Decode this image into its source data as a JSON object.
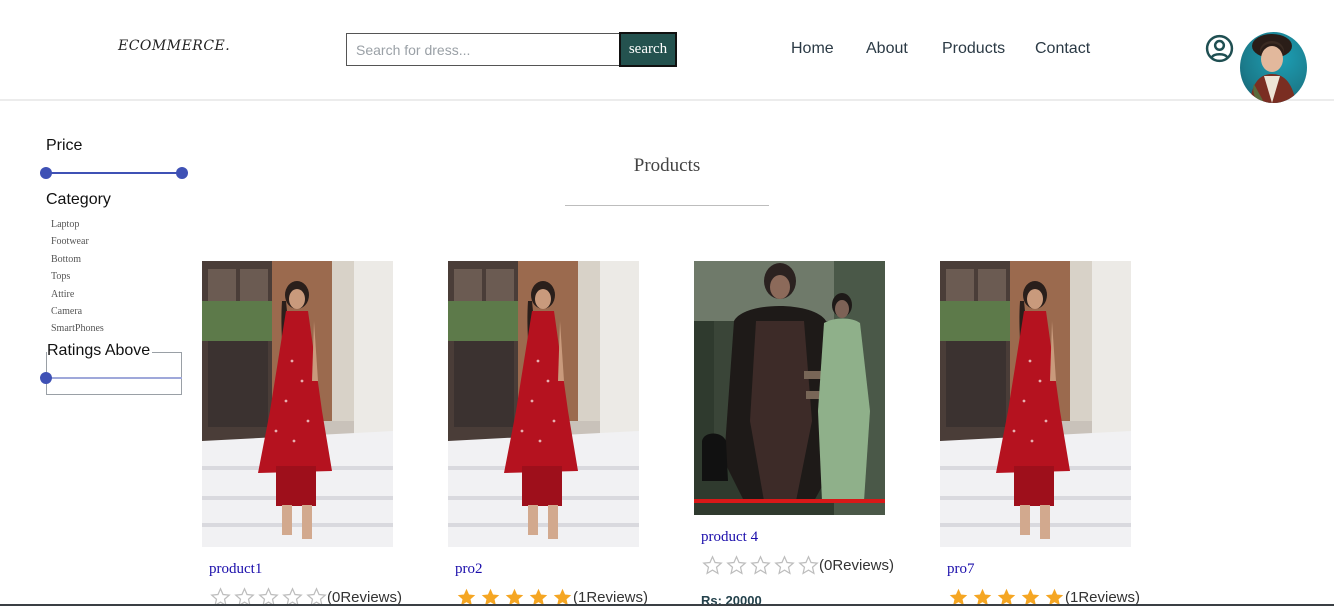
{
  "header": {
    "logo": "ECOMMERCE.",
    "search": {
      "placeholder": "Search for dress...",
      "value": "",
      "button_label": "search"
    },
    "nav": [
      "Home",
      "About",
      "Products",
      "Contact"
    ],
    "user_icon": "user-circle-icon"
  },
  "filters": {
    "price_title": "Price",
    "price_range": [
      0,
      1
    ],
    "category_title": "Category",
    "categories": [
      "Laptop",
      "Footwear",
      "Bottom",
      "Tops",
      "Attire",
      "Camera",
      "SmartPhones"
    ],
    "ratings_title": "Ratings Above",
    "ratings_value": 0
  },
  "main": {
    "title": "Products",
    "products": [
      {
        "name": "product1",
        "rating": 0,
        "reviews": "(0Reviews)",
        "price": ""
      },
      {
        "name": "pro2",
        "rating": 5,
        "reviews": "(1Reviews)",
        "price": ""
      },
      {
        "name": "product 4",
        "rating": 0,
        "reviews": "(0Reviews)",
        "price": "Rs: 20000"
      },
      {
        "name": "pro7",
        "rating": 5,
        "reviews": "(1Reviews)",
        "price": ""
      }
    ]
  },
  "colors": {
    "accent": "#3f51b5",
    "search_button": "#24524f",
    "star_filled": "#f5a623",
    "star_empty": "#bdbdbd",
    "link": "#1a0dab"
  }
}
